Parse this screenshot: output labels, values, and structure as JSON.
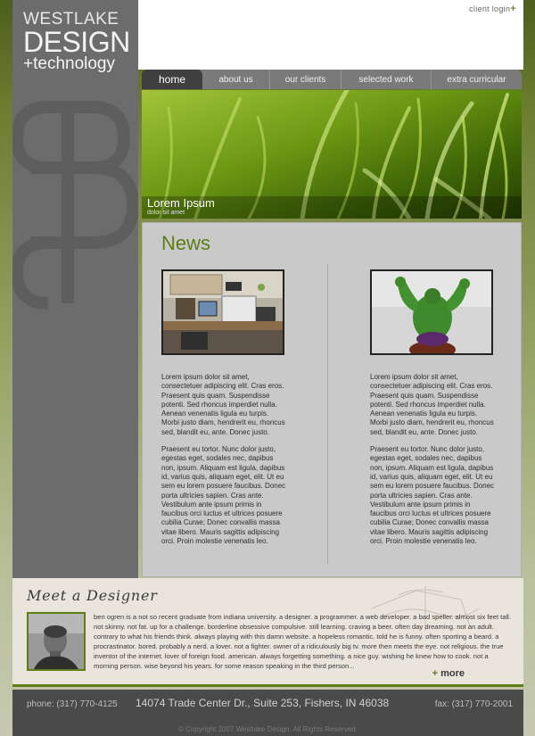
{
  "brand": {
    "line1": "WESTLAKE",
    "line2": "DESIGN",
    "line3": "+technology"
  },
  "header": {
    "client_login": "client login",
    "client_login_plus": "+"
  },
  "nav": {
    "items": [
      {
        "label": "home"
      },
      {
        "label": "about us"
      },
      {
        "label": "our clients"
      },
      {
        "label": "selected work"
      },
      {
        "label": "extra curricular"
      }
    ]
  },
  "hero": {
    "title": "Lorem Ipsum",
    "subtitle": "dolor sit amet"
  },
  "news": {
    "heading": "News",
    "columns": [
      {
        "image_icon": "office-desk-photo",
        "p1": "Lorem ipsum dolor sit amet, consectetuer adipiscing elit. Cras eros. Praesent quis quam. Suspendisse potenti. Sed rhoncus imperdiet nulla. Aenean venenatis ligula eu turpis. Morbi justo diam, hendrerit eu, rhoncus sed, blandit eu, ante. Donec justo.",
        "p2": "Praesent eu tortor. Nunc dolor justo, egestas eget, sodales nec, dapibus non, ipsum. Aliquam est ligula, dapibus id, varius quis, aliquam eget, elit. Ut eu sem eu lorem posuere faucibus. Donec porta ultricies sapien. Cras ante. Vestibulum ante ipsum primis in faucibus orci luctus et ultrices posuere cubilia Curae; Donec convallis massa vitae libero. Mauris sagittis adipiscing orci. Proin molestie venenatis leo."
      },
      {
        "image_icon": "hulk-figurine-photo",
        "p1": "Lorem ipsum dolor sit amet, consectetuer adipiscing elit. Cras eros. Praesent quis quam. Suspendisse potenti. Sed rhoncus imperdiet nulla. Aenean venenatis ligula eu turpis. Morbi justo diam, hendrerit eu, rhoncus sed, blandit eu, ante. Donec justo.",
        "p2": "Praesent eu tortor. Nunc dolor justo, egestas eget, sodales nec, dapibus non, ipsum. Aliquam est ligula, dapibus id, varius quis, aliquam eget, elit. Ut eu sem eu lorem posuere faucibus. Donec porta ultricies sapien. Cras ante. Vestibulum ante ipsum primis in faucibus orci luctus et ultrices posuere cubilia Curae; Donec convallis massa vitae libero. Mauris sagittis adipiscing orci. Proin molestie venenatis leo."
      }
    ]
  },
  "designer": {
    "title": "Meet a Designer",
    "bio": "ben ogren is a  not so recent graduate from indiana university. a designer. a programmer. a web developer. a bad speller. almost six feet tall. not skinny. not fat. up for a challenge. borderline obsessive compulsive. still learning. craving a beer. often day dreaming. not an adult. contrary to what his friends think. always playing with this damn website. a hopeless romantic. told he is funny. often sporting a beard. a procrastinator. bored. probably a nerd. a lover. not a fighter. owner of a ridiculously big tv. more then meets the eye. not religious. the true inventor of the internet. lover of foreign food. american. always forgetting something. a nice guy. wishing he knew how to cook. not a morning person. wise beyond his years. for some reason speaking in the third person...",
    "more_plus": "+",
    "more_label": "more"
  },
  "footer": {
    "phone": "phone: (317) 770-4125",
    "address": "14074 Trade Center Dr.,  Suite 253,   Fishers, IN 46038",
    "fax": "fax: (317) 770-2001",
    "copyright": "© Copyright 2007 Westlake Design. All Rights Reserved."
  },
  "colors": {
    "accent": "#5d7d16",
    "sidebar": "#6c6c6c",
    "nav_active": "#3f3f3f"
  }
}
